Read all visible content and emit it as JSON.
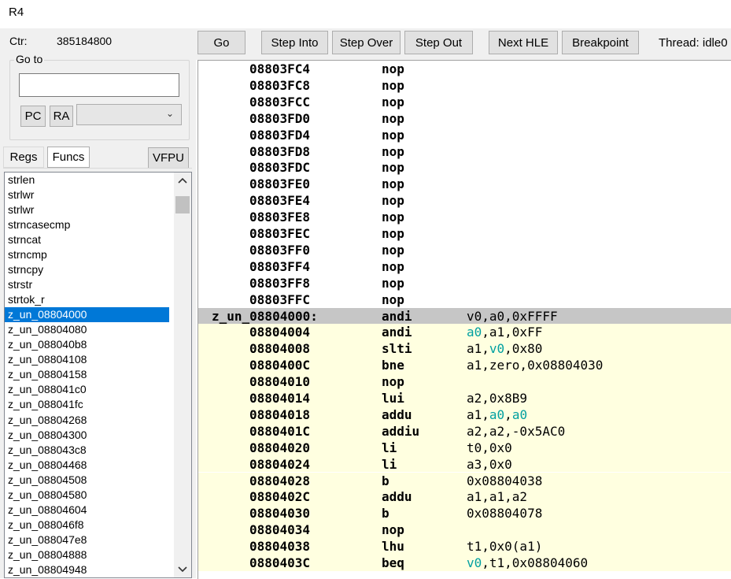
{
  "window": {
    "title": "R4"
  },
  "left": {
    "ctr_label": "Ctr:",
    "ctr_value": "385184800",
    "goto_label": "Go to",
    "goto_value": "",
    "pc_label": "PC",
    "ra_label": "RA",
    "combo_value": "",
    "tabs": {
      "regs": "Regs",
      "funcs": "Funcs",
      "vfpu": "VFPU"
    },
    "functions": [
      "strlen",
      "strlwr",
      "strlwr",
      "strncasecmp",
      "strncat",
      "strncmp",
      "strncpy",
      "strstr",
      "strtok_r",
      "z_un_08804000",
      "z_un_08804080",
      "z_un_088040b8",
      "z_un_08804108",
      "z_un_08804158",
      "z_un_088041c0",
      "z_un_088041fc",
      "z_un_08804268",
      "z_un_08804300",
      "z_un_088043c8",
      "z_un_08804468",
      "z_un_08804508",
      "z_un_08804580",
      "z_un_08804604",
      "z_un_088046f8",
      "z_un_088047e8",
      "z_un_08804888",
      "z_un_08804948"
    ],
    "selected_function": "z_un_08804000"
  },
  "toolbar": {
    "go": "Go",
    "step_into": "Step Into",
    "step_over": "Step Over",
    "step_out": "Step Out",
    "next_hle": "Next HLE",
    "breakpoint": "Breakpoint",
    "thread": "Thread: idle0"
  },
  "disassembly": [
    {
      "addr": "08803FC4",
      "op": "nop",
      "args": []
    },
    {
      "addr": "08803FC8",
      "op": "nop",
      "args": []
    },
    {
      "addr": "08803FCC",
      "op": "nop",
      "args": []
    },
    {
      "addr": "08803FD0",
      "op": "nop",
      "args": []
    },
    {
      "addr": "08803FD4",
      "op": "nop",
      "args": []
    },
    {
      "addr": "08803FD8",
      "op": "nop",
      "args": []
    },
    {
      "addr": "08803FDC",
      "op": "nop",
      "args": []
    },
    {
      "addr": "08803FE0",
      "op": "nop",
      "args": []
    },
    {
      "addr": "08803FE4",
      "op": "nop",
      "args": []
    },
    {
      "addr": "08803FE8",
      "op": "nop",
      "args": []
    },
    {
      "addr": "08803FEC",
      "op": "nop",
      "args": []
    },
    {
      "addr": "08803FF0",
      "op": "nop",
      "args": []
    },
    {
      "addr": "08803FF4",
      "op": "nop",
      "args": []
    },
    {
      "addr": "08803FF8",
      "op": "nop",
      "args": []
    },
    {
      "addr": "08803FFC",
      "op": "nop",
      "args": []
    },
    {
      "label": "z_un_08804000:",
      "op": "andi",
      "args": [
        {
          "t": "v0,a0,0xFFFF"
        }
      ],
      "current": true
    },
    {
      "addr": "08804004",
      "op": "andi",
      "args": [
        {
          "t": "a0",
          "hl": true
        },
        {
          "t": ",a1,0xFF"
        }
      ],
      "in_func": true
    },
    {
      "addr": "08804008",
      "op": "slti",
      "args": [
        {
          "t": "a1,"
        },
        {
          "t": "v0",
          "hl": true
        },
        {
          "t": ",0x80"
        }
      ],
      "in_func": true
    },
    {
      "addr": "0880400C",
      "op": "bne",
      "args": [
        {
          "t": "a1,zero,0x08804030"
        }
      ],
      "in_func": true
    },
    {
      "addr": "08804010",
      "op": "nop",
      "args": [],
      "in_func": true
    },
    {
      "addr": "08804014",
      "op": "lui",
      "args": [
        {
          "t": "a2,0x8B9"
        }
      ],
      "in_func": true
    },
    {
      "addr": "08804018",
      "op": "addu",
      "args": [
        {
          "t": "a1,"
        },
        {
          "t": "a0",
          "hl": true
        },
        {
          "t": ","
        },
        {
          "t": "a0",
          "hl": true
        }
      ],
      "in_func": true
    },
    {
      "addr": "0880401C",
      "op": "addiu",
      "args": [
        {
          "t": "a2,a2,-0x5AC0"
        }
      ],
      "in_func": true
    },
    {
      "addr": "08804020",
      "op": "li",
      "args": [
        {
          "t": "t0,0x0"
        }
      ],
      "in_func": true
    },
    {
      "addr": "08804024",
      "op": "li",
      "args": [
        {
          "t": "a3,0x0"
        }
      ],
      "in_func": true
    },
    {
      "addr": "08804028",
      "op": "b",
      "args": [
        {
          "t": "0x08804038"
        }
      ],
      "in_func": true
    },
    {
      "addr": "0880402C",
      "op": "addu",
      "args": [
        {
          "t": "a1,a1,a2"
        }
      ],
      "in_func": true
    },
    {
      "addr": "08804030",
      "op": "b",
      "args": [
        {
          "t": "0x08804078"
        }
      ],
      "in_func": true
    },
    {
      "addr": "08804034",
      "op": "nop",
      "args": [],
      "in_func": true
    },
    {
      "addr": "08804038",
      "op": "lhu",
      "args": [
        {
          "t": "t1,0x0(a1)"
        }
      ],
      "in_func": true
    },
    {
      "addr": "0880403C",
      "op": "beq",
      "args": [
        {
          "t": "v0",
          "hl": true
        },
        {
          "t": ",t1,0x08804060"
        }
      ],
      "in_func": true
    }
  ]
}
